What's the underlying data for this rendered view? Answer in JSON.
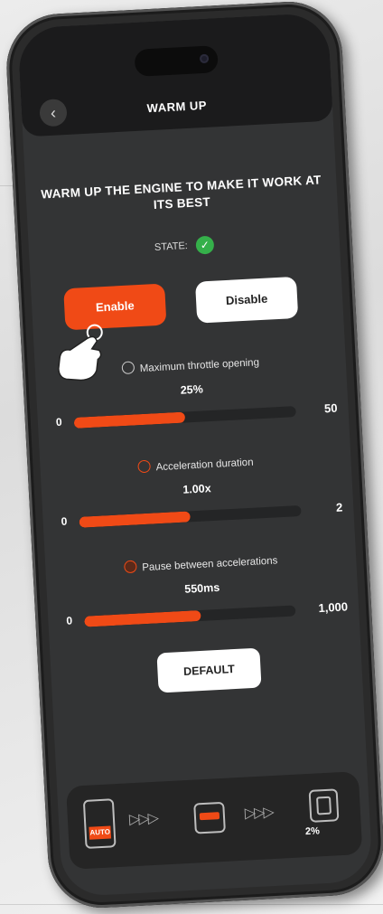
{
  "header": {
    "title": "WARM UP",
    "back_icon": "chevron-left-icon"
  },
  "headline": "WARM UP THE ENGINE TO MAKE IT WORK AT ITS BEST",
  "state": {
    "label": "STATE:",
    "icon": "check-circle-icon",
    "color": "#35b04a"
  },
  "buttons": {
    "enable": "Enable",
    "disable": "Disable",
    "default": "DEFAULT"
  },
  "params": [
    {
      "label": "Maximum throttle opening",
      "icon": "speedometer-icon",
      "value": "25%",
      "min": "0",
      "max": "50",
      "fill_fraction": 0.5
    },
    {
      "label": "Acceleration duration",
      "icon": "stopwatch-icon",
      "value": "1.00x",
      "min": "0",
      "max": "2",
      "fill_fraction": 0.5
    },
    {
      "label": "Pause between accelerations",
      "icon": "pause-circle-icon",
      "value": "550ms",
      "min": "0",
      "max": "1,000",
      "fill_fraction": 0.55
    }
  ],
  "bottom_bar": {
    "phone_tag": "AUTO",
    "ride_icon": "ride-device-icon",
    "engine_icon": "engine-icon",
    "engine_percent": "2%"
  },
  "colors": {
    "accent": "#f04a16",
    "background": "#333435",
    "header": "#1b1b1c"
  }
}
